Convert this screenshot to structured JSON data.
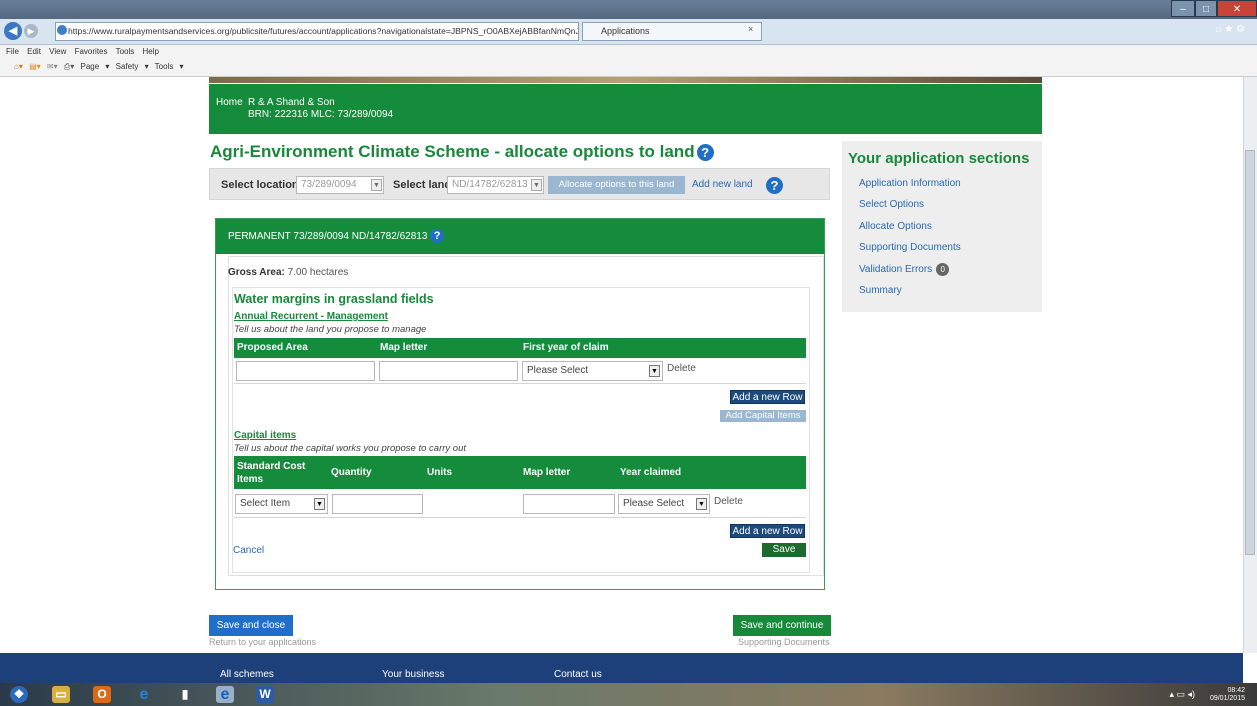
{
  "browser": {
    "url": "https://www.ruralpaymentsandservices.org/publicsite/futures/account/applications?navigationalstate=JBPNS_rO0ABXejABBfanNmQnJpZGdlVmlldw",
    "url_controls": "ρ ▾ 🔒 C ✕",
    "tab_title": "Applications",
    "tab_close": "×",
    "menu": [
      "File",
      "Edit",
      "View",
      "Favorites",
      "Tools",
      "Help"
    ],
    "command_bar": "Page ▾  Safety ▾  Tools ▾",
    "window_buttons": [
      "–",
      "□",
      "✕"
    ],
    "favorites_icons": "⌂ ★ ⚙"
  },
  "header": {
    "home": "Home",
    "business_name": "R & A Shand & Son",
    "brn_line": "BRN: 222316 MLC: 73/289/0094"
  },
  "page_title": "Agri-Environment Climate Scheme - allocate options to land",
  "help_icon": "?",
  "selection": {
    "location_label": "Select location",
    "location_value": "73/289/0094",
    "land_label": "Select land",
    "land_value": "ND/14782/62813",
    "allocate_button": "Allocate options to this land",
    "add_new_land": "Add new land"
  },
  "panel": {
    "heading": "PERMANENT 73/289/0094 ND/14782/62813",
    "gross_area_label": "Gross Area:",
    "gross_area_value": "7.00 hectares",
    "option_title": "Water margins in grassland fields",
    "management": {
      "link": "Annual Recurrent - Management",
      "hint": "Tell us about the land you propose to manage",
      "columns": [
        "Proposed Area",
        "Map letter",
        "First year of claim"
      ],
      "select_placeholder": "Please Select",
      "delete_label": "Delete",
      "add_row": "Add a new Row",
      "add_capital": "Add Capital Items"
    },
    "capital": {
      "link": "Capital items",
      "hint": "Tell us about the capital works you propose to carry out",
      "columns": [
        "Standard Cost Items",
        "Quantity",
        "Units",
        "Map letter",
        "Year claimed"
      ],
      "item_placeholder": "Select Item",
      "year_placeholder": "Please Select",
      "delete_label": "Delete",
      "add_row": "Add a new Row"
    },
    "cancel": "Cancel",
    "save": "Save"
  },
  "sidebar": {
    "title": "Your application sections",
    "items": [
      "Application Information",
      "Select Options",
      "Allocate Options",
      "Supporting Documents",
      "Validation Errors",
      "Summary"
    ],
    "validation_count": "0"
  },
  "bottom": {
    "save_close": "Save and close",
    "return_text": "Return to your applications",
    "save_continue": "Save and continue",
    "next_text": "Supporting Documents"
  },
  "footer": {
    "links": [
      "All schemes",
      "Your business",
      "Contact us"
    ]
  },
  "taskbar": {
    "time": "08:42",
    "date": "09/01/2015"
  }
}
